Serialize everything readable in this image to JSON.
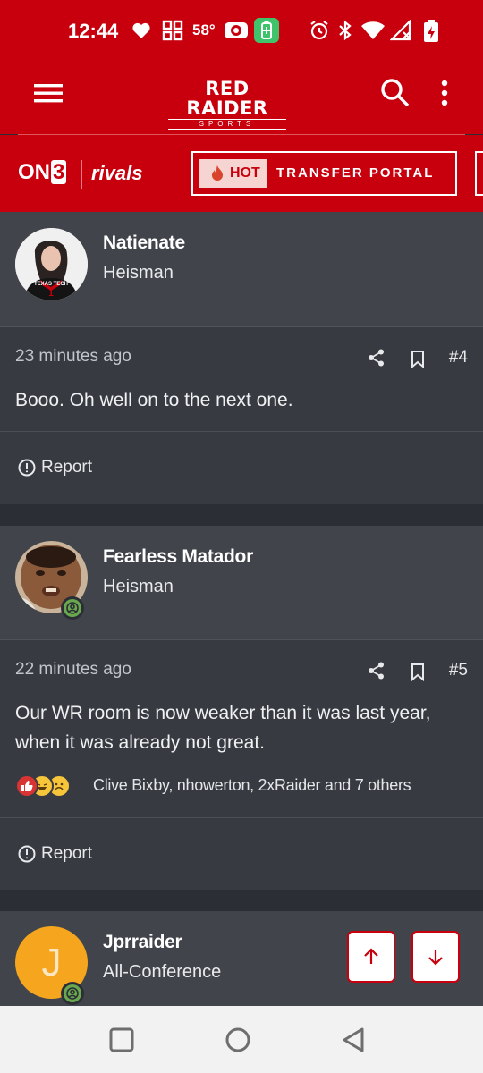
{
  "status_bar": {
    "time": "12:44",
    "temperature": "58°",
    "icons": [
      "heart-icon",
      "grid-app-icon",
      "camera-icon",
      "battery-saver-icon",
      "alarm-icon",
      "bluetooth-icon",
      "wifi-icon",
      "signal-icon",
      "battery-charging-icon"
    ]
  },
  "header": {
    "logo_main": "RED RAIDER",
    "logo_sub": "SPORTS",
    "menu_icon": "hamburger-icon",
    "search_icon": "search-icon",
    "more_icon": "more-vertical-icon"
  },
  "brand": {
    "on3_text": "ON",
    "on3_digit": "3",
    "rivals": "rivals",
    "hot_label": "HOT",
    "portal_label": "TRANSFER PORTAL"
  },
  "posts": [
    {
      "username": "Natienate",
      "rank": "Heisman",
      "time": "23 minutes ago",
      "number": "#4",
      "text": "Booo. Oh well on to the next one.",
      "avatar_text": "TEXAS TECH",
      "report": "Report"
    },
    {
      "username": "Fearless Matador",
      "rank": "Heisman",
      "time": "22 minutes ago",
      "number": "#5",
      "text": "Our WR room is now weaker than it was last year, when it was already not great.",
      "reactions": "Clive Bixby, nhowerton, 2xRaider and 7 others",
      "report": "Report"
    },
    {
      "username": "Jprraider",
      "rank": "All-Conference",
      "avatar_letter": "J"
    }
  ],
  "colors": {
    "brand_red": "#c8000e",
    "background": "#2b2f35",
    "post_head": "#41454b",
    "post_body": "#373b41",
    "online": "#6aa84f",
    "letter_avatar": "#f5a61e"
  }
}
